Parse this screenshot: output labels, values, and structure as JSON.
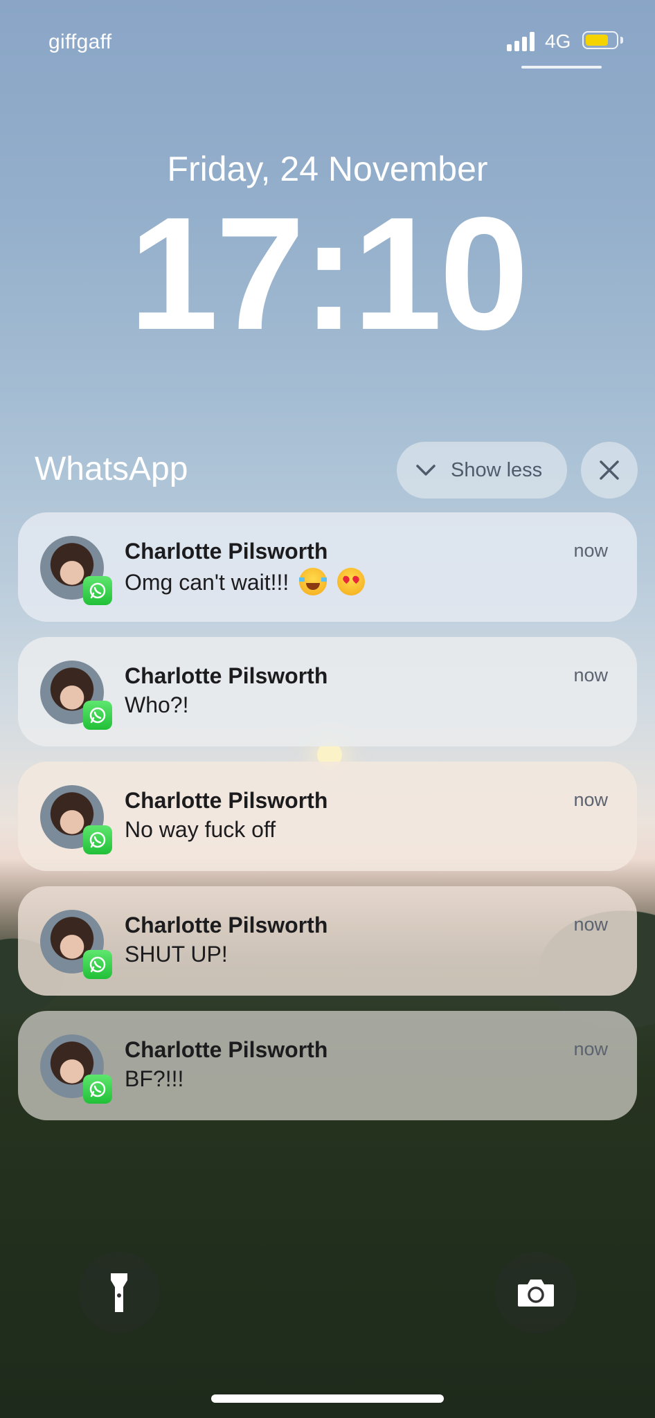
{
  "status_bar": {
    "carrier": "giffgaff",
    "network": "4G",
    "battery_level": 0.75,
    "battery_color": "#f5d300",
    "signal_bars": 4
  },
  "lock_screen": {
    "date": "Friday, 24 November",
    "time": "17:10"
  },
  "notification_group": {
    "app_name": "WhatsApp",
    "show_less_label": "Show less",
    "collapse_icon": "chevron-down-icon",
    "close_icon": "close-icon"
  },
  "notifications": [
    {
      "sender": "Charlotte Pilsworth",
      "message": "Omg can't wait!!!",
      "timestamp": "now",
      "emojis": [
        "face-with-tears-of-joy",
        "smiling-face-with-heart-eyes"
      ]
    },
    {
      "sender": "Charlotte Pilsworth",
      "message": "Who?!",
      "timestamp": "now"
    },
    {
      "sender": "Charlotte Pilsworth",
      "message": "No way fuck off",
      "timestamp": "now"
    },
    {
      "sender": "Charlotte Pilsworth",
      "message": "SHUT UP!",
      "timestamp": "now"
    },
    {
      "sender": "Charlotte Pilsworth",
      "message": "BF?!!!",
      "timestamp": "now"
    }
  ],
  "quick_actions": {
    "flashlight_icon": "flashlight-icon",
    "camera_icon": "camera-icon"
  },
  "colors": {
    "whatsapp_green": "#25d366"
  }
}
